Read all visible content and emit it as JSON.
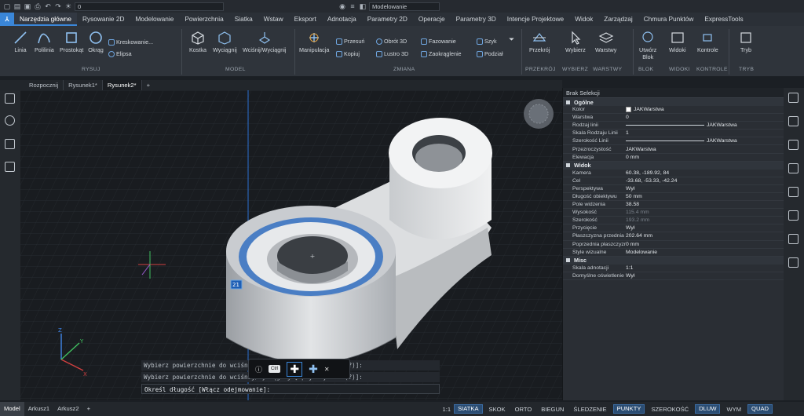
{
  "titlebar": {
    "layer": "0",
    "workspace": "Modelowanie"
  },
  "menu": {
    "tabs": [
      "Narzędzia główne",
      "Rysowanie 2D",
      "Modelowanie",
      "Powierzchnia",
      "Siatka",
      "Wstaw",
      "Eksport",
      "Adnotacja",
      "Parametry 2D",
      "Operacje",
      "Parametry 3D",
      "Intencje Projektowe",
      "Widok",
      "Zarządzaj",
      "Chmura Punktów",
      "ExpressTools"
    ]
  },
  "ribbon": {
    "draw": {
      "linia": "Linia",
      "polilinia": "Polilinia",
      "prostokat": "Prostokąt",
      "okrag": "Okrąg",
      "kreskowanie": "Kreskowanie...",
      "elipsa": "Elipsa",
      "group": "RYSUJ"
    },
    "model": {
      "kostka": "Kostka",
      "wyciagnij": "Wyciągnij",
      "wcisnij": "Wciśnij/Wyciągnij",
      "group": "MODEL"
    },
    "modify": {
      "manipulacja": "Manipulacja",
      "przesun": "Przesuń",
      "kopiuj": "Kopiuj",
      "obrot": "Obrót 3D",
      "lustro": "Lustro 3D",
      "fazowanie": "Fazowanie",
      "zaokraglenie": "Zaokrąglenie",
      "szyk": "Szyk",
      "podzial": "Podział",
      "group": "ZMIANA"
    },
    "section": {
      "przekroj": "Przekrój",
      "group": "PRZEKRÓJ"
    },
    "select": {
      "wybierz": "Wybierz",
      "group": "WYBIERZ"
    },
    "layers": {
      "warstwy": "Warstwy",
      "group": "WARSTWY"
    },
    "block": {
      "utworz": "Utwórz",
      "blok": "Blok",
      "group": "BLOK"
    },
    "views": {
      "widoki": "Widoki",
      "group": "WIDOKI"
    },
    "control": {
      "kontrole": "Kontrole",
      "group": "KONTROLE"
    },
    "mode": {
      "tryb": "Tryb",
      "group": "TRYB"
    }
  },
  "doctabs": [
    "Rozpocznij",
    "Rysunek1*",
    "Rysunek2*"
  ],
  "props": {
    "header": "Brak Selekcji",
    "sections": [
      {
        "title": "Ogólne",
        "rows": [
          [
            "Kolor",
            "JAKWarstwa"
          ],
          [
            "Warstwa",
            "0"
          ],
          [
            "Rodzaj linii",
            "JAKWarstwa"
          ],
          [
            "Skala Rodzaju Linii",
            "1"
          ],
          [
            "Szerokość Linii",
            "JAKWarstwa"
          ],
          [
            "Przezroczystość",
            "JAKWarstwa"
          ],
          [
            "Elewacja",
            "0 mm"
          ]
        ]
      },
      {
        "title": "Widok",
        "rows": [
          [
            "Kamera",
            "60.38, -189.92, 84"
          ],
          [
            "Cel",
            "-33.68, -53.33, -42.24"
          ],
          [
            "Perspektywa",
            "Wył"
          ],
          [
            "Długość obiektywu",
            "50 mm"
          ],
          [
            "Pole widzenia",
            "38.58"
          ],
          [
            "Wysokość",
            "115.4 mm"
          ],
          [
            "Szerokość",
            "193.2 mm"
          ],
          [
            "Przycięcie",
            "Wył"
          ],
          [
            "Płaszczyzna przednia",
            "202.64 mm"
          ],
          [
            "Poprzednia płaszczyzna",
            "0 mm"
          ],
          [
            "Style wizualne",
            "Modelowanie"
          ]
        ]
      },
      {
        "title": "Misc",
        "rows": [
          [
            "Skala adnotacji",
            "1:1"
          ],
          [
            "Domyślne oświetlenie",
            "Wył"
          ]
        ]
      }
    ]
  },
  "viewport": {
    "dim_value": "21",
    "ctrl_label": "Ctrl"
  },
  "cmd": {
    "line1": "Wybierz powierzchnie do wciśnij/wyciągnij [opcje wyboru (?)]:",
    "line2": "Wybierz powierzchnie do wciśnij/wyciągnij [opcje wyboru (?)]:",
    "line3": "Określ długość [Włącz odejmowanie]:"
  },
  "status": {
    "tabs": [
      "Model",
      "Arkusz1",
      "Arkusz2"
    ],
    "scale": "1:1",
    "items": [
      "SIATKA",
      "SKOK",
      "ORTO",
      "BIEGUN",
      "ŚLEDZENIE",
      "PUNKTY",
      "SZEROKOŚĆ",
      "DLUW",
      "WYM",
      "QUAD"
    ],
    "on": [
      "SIATKA",
      "PUNKTY",
      "DLUW",
      "QUAD"
    ]
  }
}
